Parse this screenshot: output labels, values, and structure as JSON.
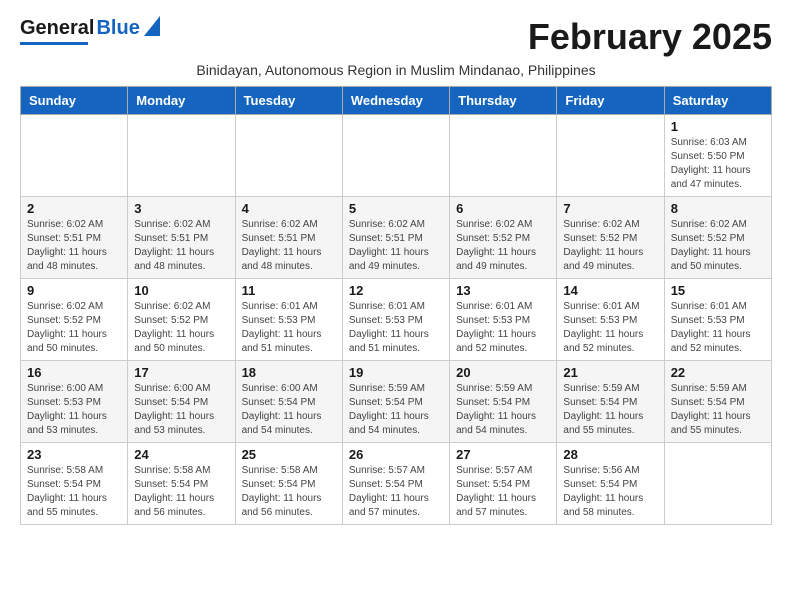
{
  "header": {
    "logo_general": "General",
    "logo_blue": "Blue",
    "month_title": "February 2025",
    "subtitle": "Binidayan, Autonomous Region in Muslim Mindanao, Philippines"
  },
  "weekdays": [
    "Sunday",
    "Monday",
    "Tuesday",
    "Wednesday",
    "Thursday",
    "Friday",
    "Saturday"
  ],
  "weeks": [
    [
      {
        "day": "",
        "info": ""
      },
      {
        "day": "",
        "info": ""
      },
      {
        "day": "",
        "info": ""
      },
      {
        "day": "",
        "info": ""
      },
      {
        "day": "",
        "info": ""
      },
      {
        "day": "",
        "info": ""
      },
      {
        "day": "1",
        "info": "Sunrise: 6:03 AM\nSunset: 5:50 PM\nDaylight: 11 hours and 47 minutes."
      }
    ],
    [
      {
        "day": "2",
        "info": "Sunrise: 6:02 AM\nSunset: 5:51 PM\nDaylight: 11 hours and 48 minutes."
      },
      {
        "day": "3",
        "info": "Sunrise: 6:02 AM\nSunset: 5:51 PM\nDaylight: 11 hours and 48 minutes."
      },
      {
        "day": "4",
        "info": "Sunrise: 6:02 AM\nSunset: 5:51 PM\nDaylight: 11 hours and 48 minutes."
      },
      {
        "day": "5",
        "info": "Sunrise: 6:02 AM\nSunset: 5:51 PM\nDaylight: 11 hours and 49 minutes."
      },
      {
        "day": "6",
        "info": "Sunrise: 6:02 AM\nSunset: 5:52 PM\nDaylight: 11 hours and 49 minutes."
      },
      {
        "day": "7",
        "info": "Sunrise: 6:02 AM\nSunset: 5:52 PM\nDaylight: 11 hours and 49 minutes."
      },
      {
        "day": "8",
        "info": "Sunrise: 6:02 AM\nSunset: 5:52 PM\nDaylight: 11 hours and 50 minutes."
      }
    ],
    [
      {
        "day": "9",
        "info": "Sunrise: 6:02 AM\nSunset: 5:52 PM\nDaylight: 11 hours and 50 minutes."
      },
      {
        "day": "10",
        "info": "Sunrise: 6:02 AM\nSunset: 5:52 PM\nDaylight: 11 hours and 50 minutes."
      },
      {
        "day": "11",
        "info": "Sunrise: 6:01 AM\nSunset: 5:53 PM\nDaylight: 11 hours and 51 minutes."
      },
      {
        "day": "12",
        "info": "Sunrise: 6:01 AM\nSunset: 5:53 PM\nDaylight: 11 hours and 51 minutes."
      },
      {
        "day": "13",
        "info": "Sunrise: 6:01 AM\nSunset: 5:53 PM\nDaylight: 11 hours and 52 minutes."
      },
      {
        "day": "14",
        "info": "Sunrise: 6:01 AM\nSunset: 5:53 PM\nDaylight: 11 hours and 52 minutes."
      },
      {
        "day": "15",
        "info": "Sunrise: 6:01 AM\nSunset: 5:53 PM\nDaylight: 11 hours and 52 minutes."
      }
    ],
    [
      {
        "day": "16",
        "info": "Sunrise: 6:00 AM\nSunset: 5:53 PM\nDaylight: 11 hours and 53 minutes."
      },
      {
        "day": "17",
        "info": "Sunrise: 6:00 AM\nSunset: 5:54 PM\nDaylight: 11 hours and 53 minutes."
      },
      {
        "day": "18",
        "info": "Sunrise: 6:00 AM\nSunset: 5:54 PM\nDaylight: 11 hours and 54 minutes."
      },
      {
        "day": "19",
        "info": "Sunrise: 5:59 AM\nSunset: 5:54 PM\nDaylight: 11 hours and 54 minutes."
      },
      {
        "day": "20",
        "info": "Sunrise: 5:59 AM\nSunset: 5:54 PM\nDaylight: 11 hours and 54 minutes."
      },
      {
        "day": "21",
        "info": "Sunrise: 5:59 AM\nSunset: 5:54 PM\nDaylight: 11 hours and 55 minutes."
      },
      {
        "day": "22",
        "info": "Sunrise: 5:59 AM\nSunset: 5:54 PM\nDaylight: 11 hours and 55 minutes."
      }
    ],
    [
      {
        "day": "23",
        "info": "Sunrise: 5:58 AM\nSunset: 5:54 PM\nDaylight: 11 hours and 55 minutes."
      },
      {
        "day": "24",
        "info": "Sunrise: 5:58 AM\nSunset: 5:54 PM\nDaylight: 11 hours and 56 minutes."
      },
      {
        "day": "25",
        "info": "Sunrise: 5:58 AM\nSunset: 5:54 PM\nDaylight: 11 hours and 56 minutes."
      },
      {
        "day": "26",
        "info": "Sunrise: 5:57 AM\nSunset: 5:54 PM\nDaylight: 11 hours and 57 minutes."
      },
      {
        "day": "27",
        "info": "Sunrise: 5:57 AM\nSunset: 5:54 PM\nDaylight: 11 hours and 57 minutes."
      },
      {
        "day": "28",
        "info": "Sunrise: 5:56 AM\nSunset: 5:54 PM\nDaylight: 11 hours and 58 minutes."
      },
      {
        "day": "",
        "info": ""
      }
    ]
  ]
}
